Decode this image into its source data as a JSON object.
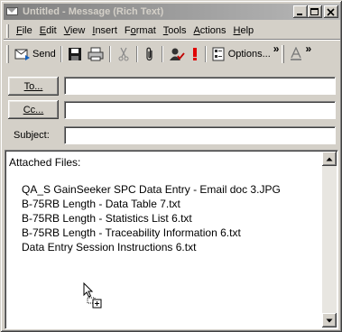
{
  "window": {
    "title": "Untitled - Message (Rich Text)",
    "buttons": {
      "minimize": "_",
      "maximize": "□",
      "close": "✕"
    }
  },
  "menu": [
    {
      "label": "File",
      "ul": "F",
      "rest": "ile"
    },
    {
      "label": "Edit",
      "ul": "E",
      "rest": "dit"
    },
    {
      "label": "View",
      "ul": "V",
      "rest": "iew"
    },
    {
      "label": "Insert",
      "ul": "I",
      "rest": "nsert"
    },
    {
      "label": "Format",
      "pre": "F",
      "ul": "o",
      "rest": "rmat"
    },
    {
      "label": "Tools",
      "ul": "T",
      "rest": "ools"
    },
    {
      "label": "Actions",
      "ul": "A",
      "rest": "ctions"
    },
    {
      "label": "Help",
      "ul": "H",
      "rest": "elp"
    }
  ],
  "toolbar": {
    "send_label": "Send",
    "options_label": "Options...",
    "more1": "»",
    "more2": "»"
  },
  "fields": {
    "to_label": "To...",
    "cc_label": "Cc...",
    "subject_label": "Subject:",
    "to_value": "",
    "cc_value": "",
    "subject_value": ""
  },
  "body": {
    "heading": "Attached Files:",
    "files": [
      "QA_S GainSeeker SPC Data Entry - Email doc 3.JPG",
      "B-75RB Length - Data Table 7.txt",
      "B-75RB Length - Statistics List 6.txt",
      "B-75RB Length - Traceability Information 6.txt",
      "Data Entry Session Instructions 6.txt"
    ]
  },
  "colors": {
    "titlebar_inactive_start": "#808080",
    "titlebar_inactive_end": "#b8b8b8",
    "face": "#d4d0c8",
    "importance_red": "#e00000"
  }
}
